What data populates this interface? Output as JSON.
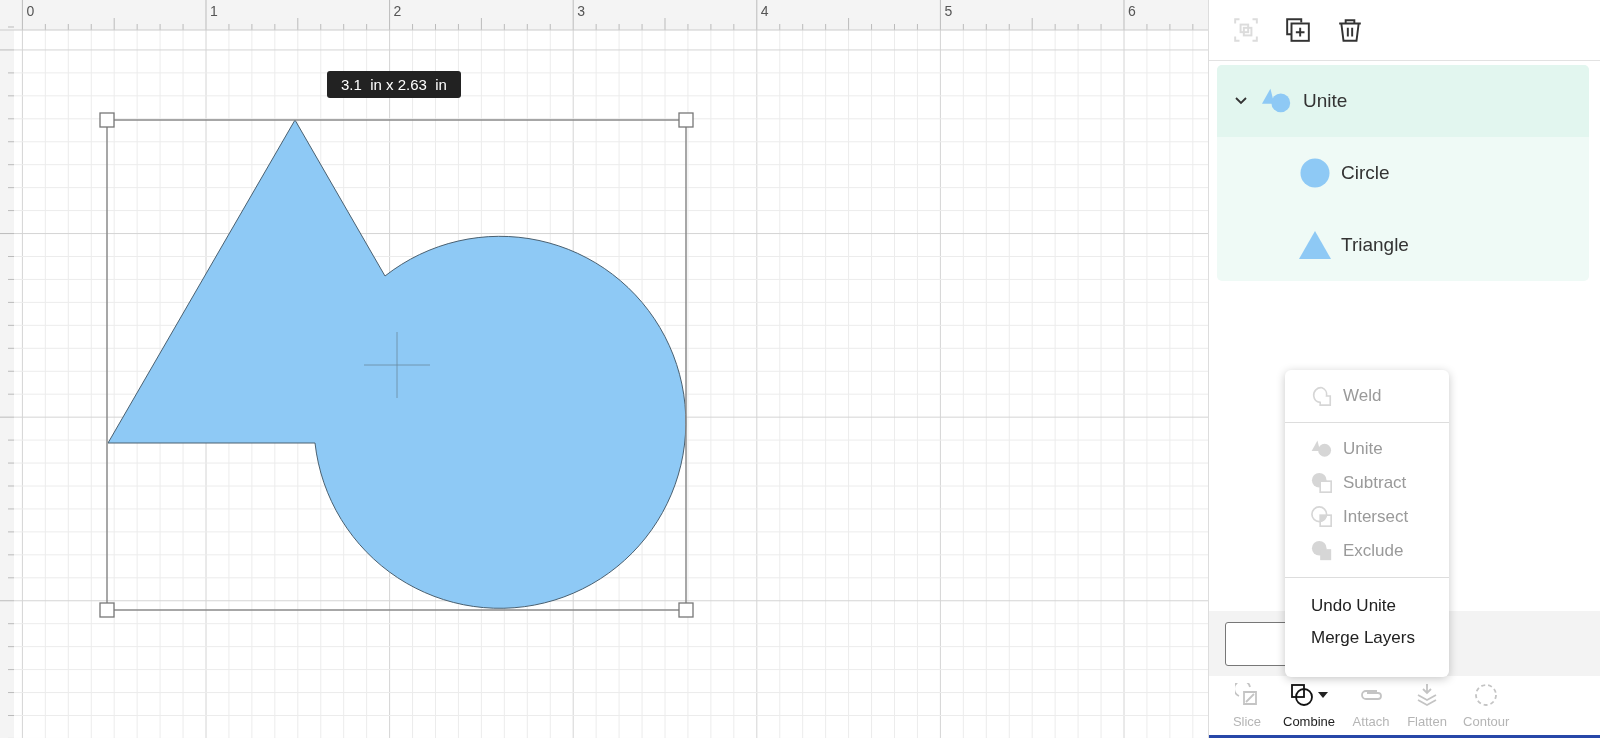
{
  "ruler": {
    "labels": [
      "0",
      "1",
      "2",
      "3",
      "4",
      "5",
      "6"
    ]
  },
  "canvas": {
    "dimension_label": "3.1  in x 2.63  in"
  },
  "panel_toolbar": [
    {
      "kind": "group",
      "disabled": true
    },
    {
      "kind": "duplicate",
      "disabled": false
    },
    {
      "kind": "delete",
      "disabled": false
    }
  ],
  "layers": [
    {
      "name": "Unite",
      "kind": "unite",
      "expanded": true,
      "selected": true,
      "children": [
        {
          "name": "Circle",
          "kind": "circle"
        },
        {
          "name": "Triangle",
          "kind": "triangle"
        }
      ]
    }
  ],
  "combine_menu": [
    [
      {
        "label": "Weld",
        "kind": "weld",
        "disabled": true
      }
    ],
    [
      {
        "label": "Unite",
        "kind": "unite",
        "disabled": true
      },
      {
        "label": "Subtract",
        "kind": "subtract",
        "disabled": true
      },
      {
        "label": "Intersect",
        "kind": "intersect",
        "disabled": true
      },
      {
        "label": "Exclude",
        "kind": "exclude",
        "disabled": true
      }
    ],
    [
      {
        "label": "Undo Unite",
        "kind": "plain",
        "disabled": false
      },
      {
        "label": "Merge Layers",
        "kind": "plain",
        "disabled": false
      }
    ]
  ],
  "tools": [
    {
      "label": "Slice",
      "kind": "slice",
      "disabled": true
    },
    {
      "label": "Combine",
      "kind": "combine",
      "disabled": false
    },
    {
      "label": "Attach",
      "kind": "attach",
      "disabled": true
    },
    {
      "label": "Flatten",
      "kind": "flatten",
      "disabled": true
    },
    {
      "label": "Contour",
      "kind": "contour",
      "disabled": true
    }
  ]
}
